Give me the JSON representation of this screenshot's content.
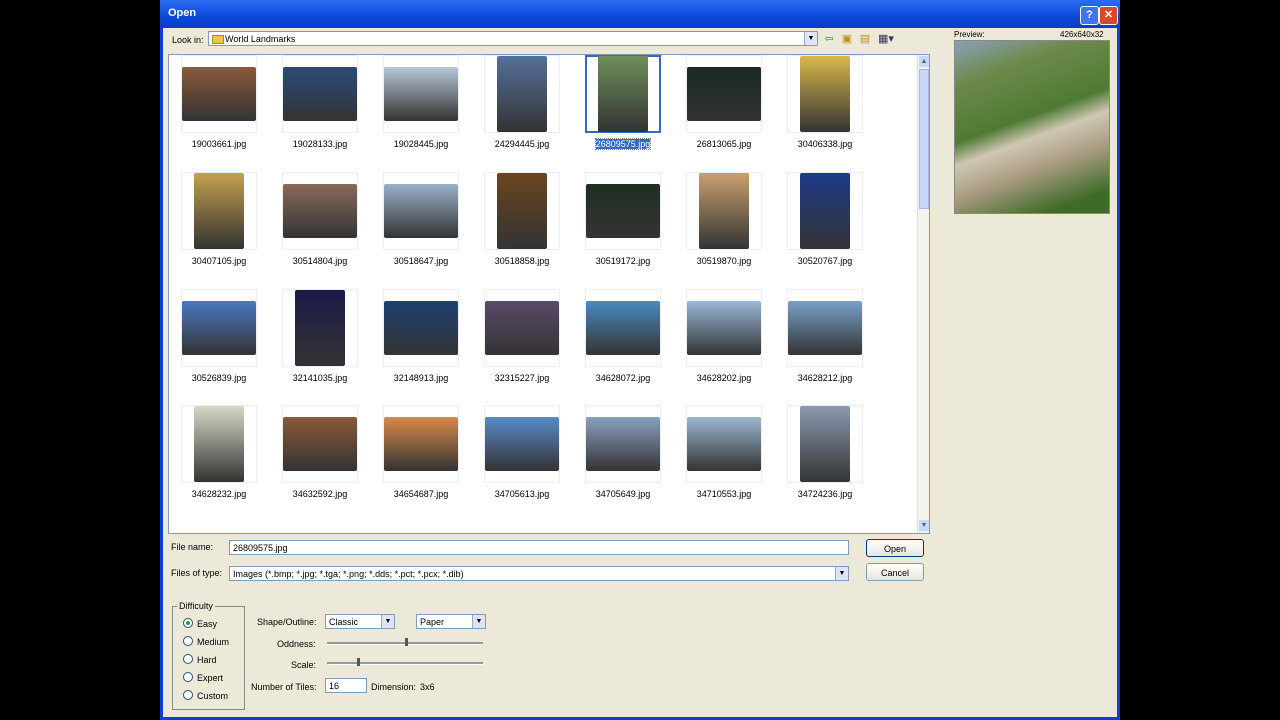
{
  "window": {
    "title": "Open",
    "help_glyph": "?",
    "close_glyph": "✕"
  },
  "lookin": {
    "label": "Look in:",
    "value": "World Landmarks"
  },
  "preview": {
    "label": "Preview:",
    "dimensions": "426x640x32"
  },
  "files": [
    {
      "name": "19003661.jpg",
      "color": "#8a5a3a",
      "tall": false
    },
    {
      "name": "19028133.jpg",
      "color": "#2b4a78",
      "tall": false
    },
    {
      "name": "19028445.jpg",
      "color": "#b7c7d8",
      "tall": false
    },
    {
      "name": "24294445.jpg",
      "color": "#56709a",
      "tall": true
    },
    {
      "name": "26809575.jpg",
      "color": "#6f8f5a",
      "tall": true,
      "selected": true
    },
    {
      "name": "26813065.jpg",
      "color": "#1a2a22",
      "tall": false
    },
    {
      "name": "30406338.jpg",
      "color": "#d9b84a",
      "tall": true
    },
    {
      "name": "30407105.jpg",
      "color": "#c4a050",
      "tall": true
    },
    {
      "name": "30514804.jpg",
      "color": "#8a6a5a",
      "tall": false
    },
    {
      "name": "30518647.jpg",
      "color": "#9ab0c8",
      "tall": false
    },
    {
      "name": "30518858.jpg",
      "color": "#6a4520",
      "tall": true
    },
    {
      "name": "30519172.jpg",
      "color": "#1e3020",
      "tall": false
    },
    {
      "name": "30519870.jpg",
      "color": "#c8a070",
      "tall": true
    },
    {
      "name": "30520767.jpg",
      "color": "#1e3a8a",
      "tall": true
    },
    {
      "name": "30526839.jpg",
      "color": "#4a78c0",
      "tall": false
    },
    {
      "name": "32141035.jpg",
      "color": "#1a1a4a",
      "tall": true
    },
    {
      "name": "32148913.jpg",
      "color": "#1e4070",
      "tall": false
    },
    {
      "name": "32315227.jpg",
      "color": "#5a4a6a",
      "tall": false
    },
    {
      "name": "34628072.jpg",
      "color": "#4a8ac0",
      "tall": false
    },
    {
      "name": "34628202.jpg",
      "color": "#9ab8d8",
      "tall": false
    },
    {
      "name": "34628212.jpg",
      "color": "#7aa0c8",
      "tall": false
    },
    {
      "name": "34628232.jpg",
      "color": "#d8d8c8",
      "tall": true
    },
    {
      "name": "34632592.jpg",
      "color": "#8a5a3a",
      "tall": false
    },
    {
      "name": "34654687.jpg",
      "color": "#d88a4a",
      "tall": false
    },
    {
      "name": "34705613.jpg",
      "color": "#5a8ac8",
      "tall": false
    },
    {
      "name": "34705649.jpg",
      "color": "#8aa0c0",
      "tall": false
    },
    {
      "name": "34710553.jpg",
      "color": "#9ab8d0",
      "tall": false
    },
    {
      "name": "34724236.jpg",
      "color": "#8a9ab0",
      "tall": true
    }
  ],
  "filename": {
    "label": "File name:",
    "value": "26809575.jpg"
  },
  "filetype": {
    "label": "Files of type:",
    "value": "Images (*.bmp; *.jpg; *.tga; *.png; *.dds; *.pct; *.pcx; *.dib)"
  },
  "buttons": {
    "open": "Open",
    "cancel": "Cancel"
  },
  "difficulty": {
    "legend": "Difficulty",
    "options": [
      "Easy",
      "Medium",
      "Hard",
      "Expert",
      "Custom"
    ],
    "selected": "Easy"
  },
  "options": {
    "shape_label": "Shape/Outline:",
    "shape_value": "Classic",
    "outline_value": "Paper",
    "oddness_label": "Oddness:",
    "scale_label": "Scale:",
    "tiles_label": "Number of Tiles:",
    "tiles_value": "16",
    "dimension_label": "Dimension:",
    "dimension_value": "3x6"
  },
  "colors": {
    "titlebar": "#0a48d8",
    "selection": "#316ac5",
    "dialog": "#ece9d8"
  }
}
